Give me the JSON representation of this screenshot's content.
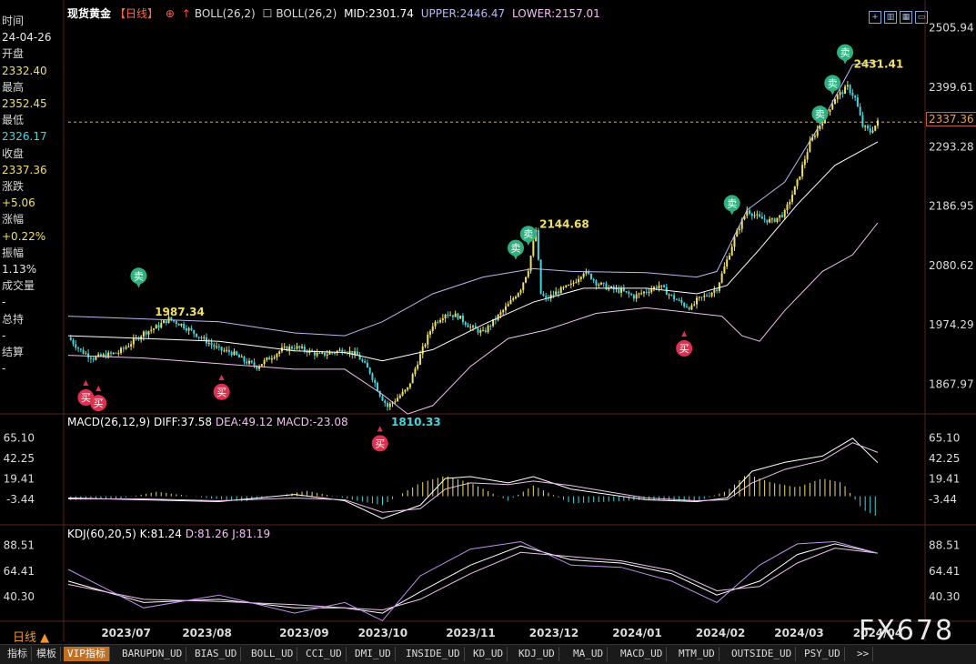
{
  "info_panel": [
    {
      "label": "时间",
      "value": "24-04-26",
      "cls": "v-w"
    },
    {
      "label": "开盘",
      "value": "2332.40",
      "cls": "v-y"
    },
    {
      "label": "最高",
      "value": "2352.45",
      "cls": "v-y"
    },
    {
      "label": "最低",
      "value": "2326.17",
      "cls": "v-c"
    },
    {
      "label": "收盘",
      "value": "2337.36",
      "cls": "v-y"
    },
    {
      "label": "涨跌",
      "value": "+5.06",
      "cls": "v-y"
    },
    {
      "label": "涨幅",
      "value": "+0.22%",
      "cls": "v-y"
    },
    {
      "label": "振幅",
      "value": "1.13%",
      "cls": "v-w"
    },
    {
      "label": "成交量",
      "value": "-",
      "cls": "v-w"
    },
    {
      "label": "总持",
      "value": "-",
      "cls": "v-w"
    },
    {
      "label": "结算",
      "value": "-",
      "cls": "v-w"
    }
  ],
  "header": {
    "symbol": "现货黄金",
    "period_tag": "【日线】",
    "boll_name": "BOLL(26,2)",
    "boll_full": "BOLL(26,2)",
    "mid": "MID:2301.74",
    "upper": "UPPER:2446.47",
    "lower": "LOWER:2157.01"
  },
  "macd_header": {
    "name": "MACD(26,12,9)",
    "diff": "DIFF:37.58",
    "dea": "DEA:49.12",
    "macd": "MACD:-23.08"
  },
  "kdj_header": {
    "name": "KDJ(60,20,5)",
    "k": "K:81.24",
    "d": "D:81.26",
    "j": "J:81.19"
  },
  "current_price": "2337.36",
  "period_button": "日线 ▲",
  "watermark": "FX678",
  "tabs": [
    "指标",
    "模板",
    "VIP指标",
    "BARUPDN_UD",
    "BIAS_UD",
    "BOLL_UD",
    "CCI_UD",
    "DMI_UD",
    "INSIDE_UD",
    "KD_UD",
    "KDJ_UD",
    "MA_UD",
    "MACD_UD",
    "MTM_UD",
    "OUTSIDE_UD",
    "PSY_UD",
    ">>"
  ],
  "colors": {
    "up": "#f0e060",
    "down": "#43d6de",
    "boll_mid": "#ffffff",
    "boll_band": "#b8b8f0",
    "lower_band": "#f0c0f0",
    "buy": "#e03050",
    "sell": "#30b080"
  },
  "chart_data": {
    "type": "candlestick",
    "title": "现货黄金 日线",
    "x_ticks": [
      "2023/07",
      "2023/08",
      "2023/09",
      "2023/10",
      "2023/11",
      "2023/12",
      "2024/01",
      "2024/02",
      "2024/03",
      "2024/04"
    ],
    "y_ticks": [
      "2505.94",
      "2399.61",
      "2293.28",
      "2186.95",
      "2080.62",
      "1974.29",
      "1867.97"
    ],
    "ylim": [
      1820,
      2520
    ],
    "price_path": [
      [
        0,
        1952
      ],
      [
        5,
        1928
      ],
      [
        10,
        1915
      ],
      [
        15,
        1920
      ],
      [
        20,
        1925
      ],
      [
        25,
        1942
      ],
      [
        30,
        1960
      ],
      [
        35,
        1970
      ],
      [
        40,
        1985
      ],
      [
        45,
        1975
      ],
      [
        50,
        1960
      ],
      [
        55,
        1945
      ],
      [
        60,
        1930
      ],
      [
        65,
        1925
      ],
      [
        70,
        1910
      ],
      [
        75,
        1900
      ],
      [
        80,
        1915
      ],
      [
        85,
        1930
      ],
      [
        90,
        1935
      ],
      [
        95,
        1928
      ],
      [
        100,
        1920
      ],
      [
        105,
        1925
      ],
      [
        110,
        1930
      ],
      [
        115,
        1920
      ],
      [
        120,
        1890
      ],
      [
        124,
        1850
      ],
      [
        127,
        1828
      ],
      [
        130,
        1840
      ],
      [
        135,
        1860
      ],
      [
        140,
        1920
      ],
      [
        145,
        1975
      ],
      [
        150,
        1995
      ],
      [
        155,
        1990
      ],
      [
        160,
        1970
      ],
      [
        165,
        1960
      ],
      [
        170,
        1985
      ],
      [
        175,
        2010
      ],
      [
        180,
        2040
      ],
      [
        183,
        2075
      ],
      [
        186,
        2144
      ],
      [
        188,
        2030
      ],
      [
        190,
        2020
      ],
      [
        195,
        2035
      ],
      [
        200,
        2045
      ],
      [
        205,
        2070
      ],
      [
        208,
        2060
      ],
      [
        210,
        2050
      ],
      [
        215,
        2040
      ],
      [
        220,
        2035
      ],
      [
        225,
        2025
      ],
      [
        230,
        2035
      ],
      [
        235,
        2045
      ],
      [
        240,
        2025
      ],
      [
        245,
        2010
      ],
      [
        248,
        2005
      ],
      [
        250,
        2018
      ],
      [
        255,
        2030
      ],
      [
        258,
        2040
      ],
      [
        262,
        2090
      ],
      [
        265,
        2130
      ],
      [
        268,
        2160
      ],
      [
        270,
        2180
      ],
      [
        275,
        2165
      ],
      [
        280,
        2160
      ],
      [
        285,
        2175
      ],
      [
        290,
        2230
      ],
      [
        295,
        2300
      ],
      [
        300,
        2340
      ],
      [
        305,
        2380
      ],
      [
        310,
        2400
      ],
      [
        313,
        2380
      ],
      [
        316,
        2330
      ],
      [
        319,
        2320
      ],
      [
        322,
        2337
      ]
    ],
    "labeled_points": [
      {
        "text": "1987.34",
        "t": 33,
        "v": 1987.34,
        "color": "#f0e060"
      },
      {
        "text": "1810.33",
        "t": 127,
        "v": 1810.33,
        "color": "#43d6de"
      },
      {
        "text": "2144.68",
        "t": 186,
        "v": 2144.68,
        "color": "#f0e060"
      },
      {
        "text": "2431.41",
        "t": 311,
        "v": 2431.41,
        "color": "#f0e060"
      }
    ],
    "signals": [
      {
        "type": "买",
        "t": 7,
        "v": 1890
      },
      {
        "type": "买",
        "t": 12,
        "v": 1880
      },
      {
        "type": "卖",
        "t": 28,
        "v": 2010
      },
      {
        "type": "买",
        "t": 61,
        "v": 1900
      },
      {
        "type": "买",
        "t": 124,
        "v": 1808
      },
      {
        "type": "卖",
        "t": 178,
        "v": 2060
      },
      {
        "type": "卖",
        "t": 183,
        "v": 2085
      },
      {
        "type": "买",
        "t": 245,
        "v": 1978
      },
      {
        "type": "卖",
        "t": 264,
        "v": 2140
      },
      {
        "type": "卖",
        "t": 299,
        "v": 2300
      },
      {
        "type": "卖",
        "t": 304,
        "v": 2355
      },
      {
        "type": "卖",
        "t": 309,
        "v": 2410
      }
    ],
    "boll_upper_path": [
      [
        0,
        1990
      ],
      [
        30,
        1985
      ],
      [
        60,
        1980
      ],
      [
        90,
        1960
      ],
      [
        110,
        1955
      ],
      [
        125,
        1980
      ],
      [
        145,
        2030
      ],
      [
        165,
        2060
      ],
      [
        185,
        2075
      ],
      [
        200,
        2070
      ],
      [
        230,
        2068
      ],
      [
        250,
        2060
      ],
      [
        258,
        2070
      ],
      [
        270,
        2180
      ],
      [
        285,
        2230
      ],
      [
        300,
        2340
      ],
      [
        312,
        2440
      ],
      [
        322,
        2446
      ]
    ],
    "boll_mid_path": [
      [
        0,
        1955
      ],
      [
        30,
        1950
      ],
      [
        60,
        1945
      ],
      [
        90,
        1928
      ],
      [
        110,
        1925
      ],
      [
        125,
        1910
      ],
      [
        145,
        1930
      ],
      [
        165,
        1975
      ],
      [
        185,
        2015
      ],
      [
        205,
        2040
      ],
      [
        230,
        2040
      ],
      [
        250,
        2030
      ],
      [
        262,
        2045
      ],
      [
        275,
        2110
      ],
      [
        290,
        2190
      ],
      [
        305,
        2260
      ],
      [
        322,
        2302
      ]
    ],
    "boll_lower_path": [
      [
        0,
        1920
      ],
      [
        30,
        1915
      ],
      [
        60,
        1905
      ],
      [
        90,
        1895
      ],
      [
        110,
        1895
      ],
      [
        125,
        1850
      ],
      [
        135,
        1815
      ],
      [
        145,
        1830
      ],
      [
        160,
        1900
      ],
      [
        175,
        1950
      ],
      [
        190,
        1965
      ],
      [
        210,
        1995
      ],
      [
        230,
        2005
      ],
      [
        250,
        1995
      ],
      [
        260,
        1990
      ],
      [
        268,
        1955
      ],
      [
        275,
        1945
      ],
      [
        285,
        2000
      ],
      [
        300,
        2070
      ],
      [
        312,
        2100
      ],
      [
        322,
        2157
      ]
    ],
    "macd": {
      "y_ticks": [
        "65.10",
        "42.25",
        "19.41",
        "-3.44"
      ],
      "ylim": [
        -30,
        75
      ],
      "diff_path": [
        [
          0,
          -2
        ],
        [
          30,
          -4
        ],
        [
          60,
          -6
        ],
        [
          90,
          2
        ],
        [
          110,
          -5
        ],
        [
          125,
          -25
        ],
        [
          140,
          -10
        ],
        [
          150,
          20
        ],
        [
          160,
          22
        ],
        [
          175,
          15
        ],
        [
          185,
          22
        ],
        [
          200,
          8
        ],
        [
          215,
          2
        ],
        [
          230,
          -4
        ],
        [
          250,
          -6
        ],
        [
          262,
          -2
        ],
        [
          272,
          28
        ],
        [
          285,
          38
        ],
        [
          300,
          45
        ],
        [
          312,
          65
        ],
        [
          322,
          37.58
        ]
      ],
      "dea_path": [
        [
          0,
          -3
        ],
        [
          30,
          -3
        ],
        [
          60,
          -5
        ],
        [
          90,
          -2
        ],
        [
          110,
          -4
        ],
        [
          125,
          -18
        ],
        [
          140,
          -14
        ],
        [
          150,
          8
        ],
        [
          160,
          15
        ],
        [
          175,
          13
        ],
        [
          185,
          17
        ],
        [
          200,
          12
        ],
        [
          215,
          5
        ],
        [
          230,
          -2
        ],
        [
          250,
          -5
        ],
        [
          262,
          -4
        ],
        [
          272,
          15
        ],
        [
          285,
          30
        ],
        [
          300,
          40
        ],
        [
          312,
          60
        ],
        [
          322,
          49.12
        ]
      ],
      "hist": [
        [
          5,
          -4
        ],
        [
          20,
          -3
        ],
        [
          35,
          5
        ],
        [
          55,
          -2
        ],
        [
          70,
          -6
        ],
        [
          95,
          6
        ],
        [
          115,
          -5
        ],
        [
          125,
          -10
        ],
        [
          140,
          15
        ],
        [
          150,
          23
        ],
        [
          160,
          15
        ],
        [
          175,
          -5
        ],
        [
          185,
          12
        ],
        [
          200,
          -8
        ],
        [
          215,
          -6
        ],
        [
          230,
          -4
        ],
        [
          250,
          -6
        ],
        [
          262,
          6
        ],
        [
          270,
          25
        ],
        [
          280,
          15
        ],
        [
          290,
          10
        ],
        [
          300,
          20
        ],
        [
          308,
          15
        ],
        [
          316,
          -15
        ],
        [
          322,
          -23.08
        ]
      ]
    },
    "kdj": {
      "y_ticks": [
        "88.51",
        "64.41",
        "40.30"
      ],
      "ylim": [
        20,
        95
      ],
      "k_path": [
        [
          0,
          55
        ],
        [
          30,
          35
        ],
        [
          60,
          38
        ],
        [
          90,
          30
        ],
        [
          110,
          30
        ],
        [
          125,
          25
        ],
        [
          140,
          45
        ],
        [
          160,
          70
        ],
        [
          180,
          88
        ],
        [
          200,
          75
        ],
        [
          220,
          72
        ],
        [
          240,
          62
        ],
        [
          258,
          42
        ],
        [
          275,
          55
        ],
        [
          290,
          80
        ],
        [
          305,
          90
        ],
        [
          322,
          81.24
        ]
      ],
      "d_path": [
        [
          0,
          52
        ],
        [
          30,
          38
        ],
        [
          60,
          36
        ],
        [
          90,
          33
        ],
        [
          110,
          30
        ],
        [
          125,
          28
        ],
        [
          140,
          38
        ],
        [
          160,
          62
        ],
        [
          180,
          82
        ],
        [
          200,
          78
        ],
        [
          220,
          74
        ],
        [
          240,
          65
        ],
        [
          258,
          46
        ],
        [
          275,
          50
        ],
        [
          290,
          72
        ],
        [
          305,
          86
        ],
        [
          322,
          81.26
        ]
      ],
      "j_path": [
        [
          0,
          66
        ],
        [
          30,
          30
        ],
        [
          60,
          42
        ],
        [
          90,
          25
        ],
        [
          110,
          35
        ],
        [
          125,
          18
        ],
        [
          140,
          60
        ],
        [
          160,
          85
        ],
        [
          180,
          92
        ],
        [
          200,
          70
        ],
        [
          220,
          68
        ],
        [
          240,
          55
        ],
        [
          258,
          35
        ],
        [
          275,
          70
        ],
        [
          290,
          90
        ],
        [
          305,
          92
        ],
        [
          322,
          81.19
        ]
      ]
    }
  }
}
